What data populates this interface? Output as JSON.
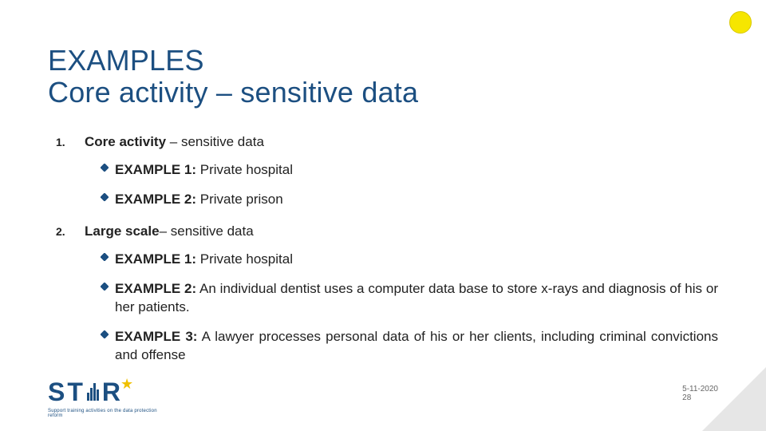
{
  "title_line1": "EXAMPLES",
  "title_line2": "Core activity – sensitive data",
  "sections": {
    "0": {
      "num": "1.",
      "heading_html": "<b>Core activity</b> – sensitive data",
      "items": {
        "0": "<b>EXAMPLE 1:</b> Private hospital",
        "1": "<b>EXAMPLE 2:</b> Private prison"
      }
    },
    "1": {
      "num": "2.",
      "heading_html": "<b>Large scale</b>– sensitive data",
      "items": {
        "0": "<b>EXAMPLE 1:</b> Private hospital",
        "1": "<b>EXAMPLE 2:</b> An individual dentist uses a computer data base to store x-rays and diagnosis of his or her patients.",
        "2": "<b>EXAMPLE 3:</b> A lawyer processes personal data of his or her clients, including criminal convictions and offense"
      }
    }
  },
  "logo": {
    "letters": {
      "s": "S",
      "t": "T",
      "r": "R"
    },
    "tagline": "Support training activities on the data protection reform"
  },
  "footer": {
    "date": "5-11-2020",
    "page": "28"
  }
}
